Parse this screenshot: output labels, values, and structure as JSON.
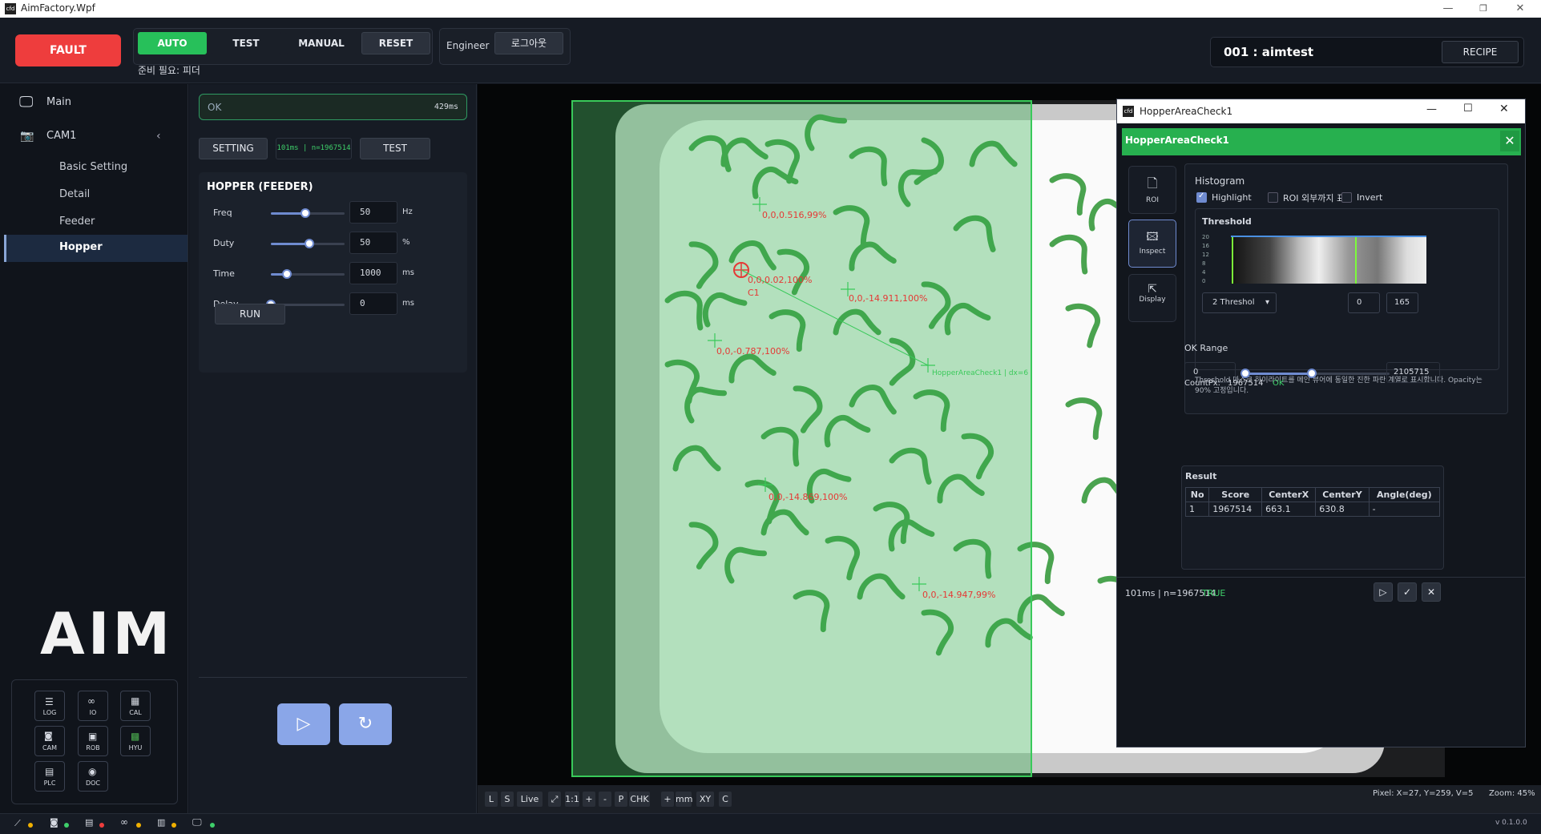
{
  "window": {
    "title": "AimFactory.Wpf",
    "app_icon_text": "cfd"
  },
  "top": {
    "fault": "FAULT",
    "modes": [
      "AUTO",
      "TEST",
      "MANUAL",
      "RESET"
    ],
    "status_text": "준비 필요: 피더",
    "role": "Engineer",
    "logout": "로그아웃",
    "recipe_name": "001 : aimtest",
    "recipe_btn": "RECIPE"
  },
  "nav": {
    "main": "Main",
    "cam": "CAM1",
    "subitems": [
      "Basic Setting",
      "Detail",
      "Feeder",
      "Hopper"
    ]
  },
  "logo": "AIM",
  "quick": [
    "LOG",
    "IO",
    "CAL",
    "CAM",
    "ROB",
    "HYU",
    "PLC",
    "DOC"
  ],
  "panel": {
    "ok_text": "OK",
    "ok_time": "429ms",
    "setting": "SETTING",
    "perf": "101ms | n=1967514",
    "test": "TEST",
    "section": "HOPPER (FEEDER)",
    "params": [
      {
        "label": "Freq",
        "value": "50",
        "unit": "Hz",
        "level": 0.47
      },
      {
        "label": "Duty",
        "value": "50",
        "unit": "%",
        "level": 0.52
      },
      {
        "label": "Time",
        "value": "1000",
        "unit": "ms",
        "level": 0.22
      },
      {
        "label": "Delay",
        "value": "0",
        "unit": "ms",
        "level": 0.0
      }
    ],
    "run": "RUN"
  },
  "overlay": {
    "labels": [
      "0,0,0.516,99%",
      "0,0,0.02,100%",
      "C1",
      "0,0,-14.911,100%",
      "0,0,-0.787,100%",
      "HopperAreaCheck1 | dx=6",
      "0,0,-14.869,100%",
      "0,0,-14.947,99%"
    ]
  },
  "toolbar": {
    "buttons": [
      "L",
      "S",
      "Live",
      "⤢",
      "1:1",
      "+",
      "-",
      "P",
      "CHK",
      "+",
      "mm",
      "XY",
      "C"
    ],
    "pixel": "Pixel:  X=27, Y=259, V=5",
    "zoom": "Zoom: 45%"
  },
  "dialog": {
    "window_title": "HopperAreaCheck1",
    "header": "HopperAreaCheck1",
    "tabs": [
      "ROI",
      "Inspect",
      "Display"
    ],
    "histogram": {
      "title": "Histogram",
      "highlight": "Highlight",
      "roi_outside": "ROI 외부까지 표시",
      "invert": "Invert",
      "threshold_title": "Threshold",
      "yticks": [
        "20",
        "16",
        "12",
        "8",
        "4",
        "0"
      ],
      "mode": "2 Threshol",
      "low": "0",
      "high": "165",
      "note": "Threshold 마스크 하이라이트를 메인 뷰어에 동일한 진한 파란 계열로 표시합니다. Opacity는 90% 고정입니다."
    },
    "okrange": {
      "title": "OK Range",
      "min": "0",
      "max": "2105715",
      "low_level": 0.0,
      "high_level": 0.46
    },
    "countpx_label": "CountPx:",
    "countpx": "1967514",
    "count_status": "OK",
    "result": {
      "title": "Result",
      "headers": [
        "No",
        "Score",
        "CenterX",
        "CenterY",
        "Angle(deg)"
      ],
      "rows": [
        [
          "1",
          "1967514",
          "663.1",
          "630.8",
          "-"
        ]
      ]
    },
    "footer": "101ms | n=1967514",
    "footer_status": "TRUE"
  },
  "version": "v 0.1.0.0",
  "colors": {
    "fault": "#ee3d3d",
    "auto": "#27c05a",
    "accent": "#6f8bd0",
    "green_overlay": "#2fae4a",
    "label_red": "#e53935"
  }
}
